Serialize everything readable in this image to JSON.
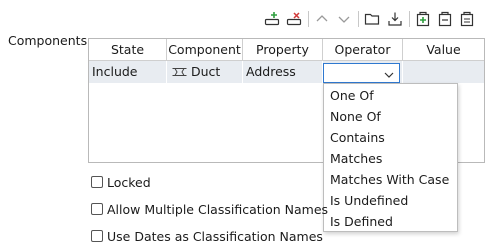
{
  "section_label": "Components",
  "table": {
    "headers": [
      "State",
      "Component",
      "Property",
      "Operator",
      "Value"
    ],
    "row": {
      "state": "Include",
      "component": "Duct",
      "property": "Address",
      "operator": "",
      "value": ""
    }
  },
  "dropdown_options": [
    "One Of",
    "None Of",
    "Contains",
    "Matches",
    "Matches With Case",
    "Is Undefined",
    "Is Defined"
  ],
  "checkboxes": [
    {
      "label": "Locked",
      "checked": false
    },
    {
      "label": "Allow Multiple Classification Names",
      "checked": false
    },
    {
      "label": "Use Dates as Classification Names",
      "checked": false
    }
  ],
  "colors": {
    "accent": "#2f79d0",
    "add": "#2e9e3e",
    "remove": "#d13a3a",
    "selected_row": "#e8ecf1"
  }
}
